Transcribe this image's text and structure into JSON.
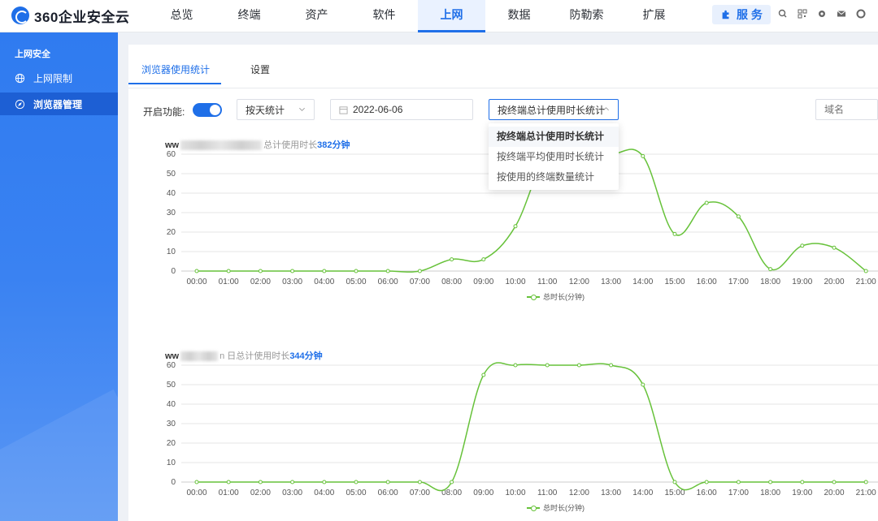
{
  "header": {
    "logo_text": "360企业安全云",
    "nav": [
      "总览",
      "终端",
      "资产",
      "软件",
      "上网",
      "数据",
      "防勒索",
      "扩展"
    ],
    "active_nav_index": 4,
    "service_label": "服 务"
  },
  "sidebar": {
    "section_title": "上网安全",
    "items": [
      {
        "label": "上网限制",
        "icon": "globe-icon"
      },
      {
        "label": "浏览器管理",
        "icon": "compass-icon"
      }
    ],
    "active_index": 1
  },
  "tabs": {
    "items": [
      "浏览器使用统计",
      "设置"
    ],
    "active_index": 0
  },
  "toolbar": {
    "enable_label": "开启功能:",
    "enable_on": true,
    "period_select": "按天统计",
    "date_value": "2022-06-06",
    "stat_select": "按终端总计使用时长统计",
    "domain_placeholder": "域名"
  },
  "dropdown": {
    "options": [
      "按终端总计使用时长统计",
      "按终端平均使用时长统计",
      "按使用的终端数量统计"
    ],
    "selected_index": 0
  },
  "colors": {
    "accent": "#1f6fe8",
    "series": "#67c23a"
  },
  "chart_data": [
    {
      "type": "line",
      "title_prefix": "ww",
      "title_middle": "总计使用时长",
      "title_value": "382分钟",
      "x": [
        "00:00",
        "01:00",
        "02:00",
        "03:00",
        "04:00",
        "05:00",
        "06:00",
        "07:00",
        "08:00",
        "09:00",
        "10:00",
        "11:00",
        "12:00",
        "13:00",
        "14:00",
        "15:00",
        "16:00",
        "17:00",
        "18:00",
        "19:00",
        "20:00",
        "21:00"
      ],
      "series": [
        {
          "name": "总时长(分钟)",
          "values": [
            0,
            0,
            0,
            0,
            0,
            0,
            0,
            0,
            6,
            6,
            23,
            60,
            60,
            60,
            59,
            19,
            35,
            28,
            1,
            13,
            12,
            0
          ]
        }
      ],
      "ylim": [
        0,
        60
      ],
      "yticks": [
        0,
        10,
        20,
        30,
        40,
        50,
        60
      ],
      "grid": true,
      "legend": "bottom-center"
    },
    {
      "type": "line",
      "title_prefix": "ww",
      "title_middle": "n 日总计使用时长",
      "title_value": "344分钟",
      "x": [
        "00:00",
        "01:00",
        "02:00",
        "03:00",
        "04:00",
        "05:00",
        "06:00",
        "07:00",
        "08:00",
        "09:00",
        "10:00",
        "11:00",
        "12:00",
        "13:00",
        "14:00",
        "15:00",
        "16:00",
        "17:00",
        "18:00",
        "19:00",
        "20:00",
        "21:00"
      ],
      "series": [
        {
          "name": "总时长(分钟)",
          "values": [
            0,
            0,
            0,
            0,
            0,
            0,
            0,
            0,
            0,
            55,
            60,
            60,
            60,
            60,
            50,
            0,
            0,
            0,
            0,
            0,
            0,
            0
          ]
        }
      ],
      "ylim": [
        0,
        60
      ],
      "yticks": [
        0,
        10,
        20,
        30,
        40,
        50,
        60
      ],
      "grid": true,
      "legend": "bottom-center"
    }
  ]
}
